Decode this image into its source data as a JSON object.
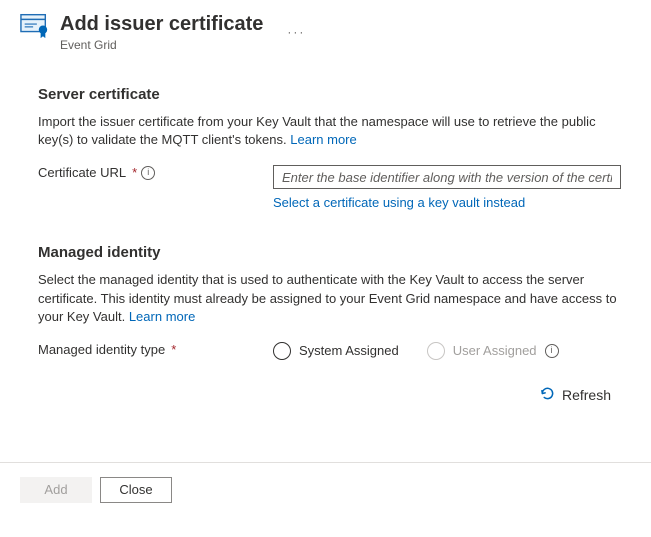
{
  "header": {
    "title": "Add issuer certificate",
    "subtitle": "Event Grid",
    "more_label": "···"
  },
  "server_cert": {
    "heading": "Server certificate",
    "description": "Import the issuer certificate from your Key Vault that the namespace will use to retrieve the public key(s) to validate the MQTT client's tokens.",
    "learn_more": "Learn more",
    "field_label": "Certificate URL",
    "placeholder": "Enter the base identifier along with the version of the certificate",
    "kv_link": "Select a certificate using a key vault instead"
  },
  "managed_identity": {
    "heading": "Managed identity",
    "description": "Select the managed identity that is used to authenticate with the Key Vault to access the server certificate. This identity must already be assigned to your Event Grid namespace and have access to your Key Vault.",
    "learn_more": "Learn more",
    "type_label": "Managed identity type",
    "options": {
      "system": "System Assigned",
      "user": "User Assigned"
    },
    "refresh": "Refresh"
  },
  "footer": {
    "add": "Add",
    "close": "Close"
  }
}
